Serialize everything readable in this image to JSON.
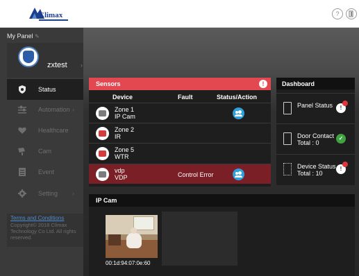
{
  "brand": {
    "logo_text": "Climax"
  },
  "topbar": {
    "help_icon": "help-icon",
    "logout_icon": "logout-icon"
  },
  "sidebar": {
    "panel_label": "My Panel",
    "panel_icon": "edit-icon",
    "username": "zxtest",
    "items": [
      {
        "label": "Status",
        "icon": "shield-icon",
        "active": true
      },
      {
        "label": "Automation",
        "icon": "sliders-icon",
        "active": false,
        "has_arrow": true
      },
      {
        "label": "Healthcare",
        "icon": "heart-icon",
        "active": false
      },
      {
        "label": "Cam",
        "icon": "camera-icon",
        "active": false
      },
      {
        "label": "Event",
        "icon": "list-icon",
        "active": false
      },
      {
        "label": "Setting",
        "icon": "gear-icon",
        "active": false,
        "has_arrow": true
      }
    ],
    "terms_link": "Terms and Conditions",
    "copyright": "Copyright© 2018 Climax Technology Co Ltd. All rights reserved."
  },
  "sensors": {
    "title": "Sensors",
    "columns": {
      "device": "Device",
      "fault": "Fault",
      "status": "Status/Action"
    },
    "rows": [
      {
        "zone": "Zone 1",
        "type": "IP Cam",
        "fault": "",
        "icon": "ipcam-sensor-icon",
        "action": true,
        "alarm": false
      },
      {
        "zone": "Zone 2",
        "type": "IR",
        "fault": "",
        "icon": "ir-sensor-icon",
        "action": false,
        "alarm": false
      },
      {
        "zone": "Zone 5",
        "type": "WTR",
        "fault": "",
        "icon": "water-sensor-icon",
        "action": false,
        "alarm": false
      },
      {
        "zone": "vdp",
        "type": "VDP",
        "fault": "Control Error",
        "icon": "vdp-sensor-icon",
        "action": true,
        "alarm": true
      }
    ]
  },
  "dashboard": {
    "title": "Dashboard",
    "items": [
      {
        "label": "Panel Status",
        "sub": "",
        "status": "warning"
      },
      {
        "label": "Door Contact",
        "sub": "Total : 0",
        "status": "ok"
      },
      {
        "label": "Device Status",
        "sub": "Total : 10",
        "status": "warning"
      }
    ]
  },
  "ipcam": {
    "title": "IP Cam",
    "camera_id": "00:1d:94:07:0e:60"
  }
}
